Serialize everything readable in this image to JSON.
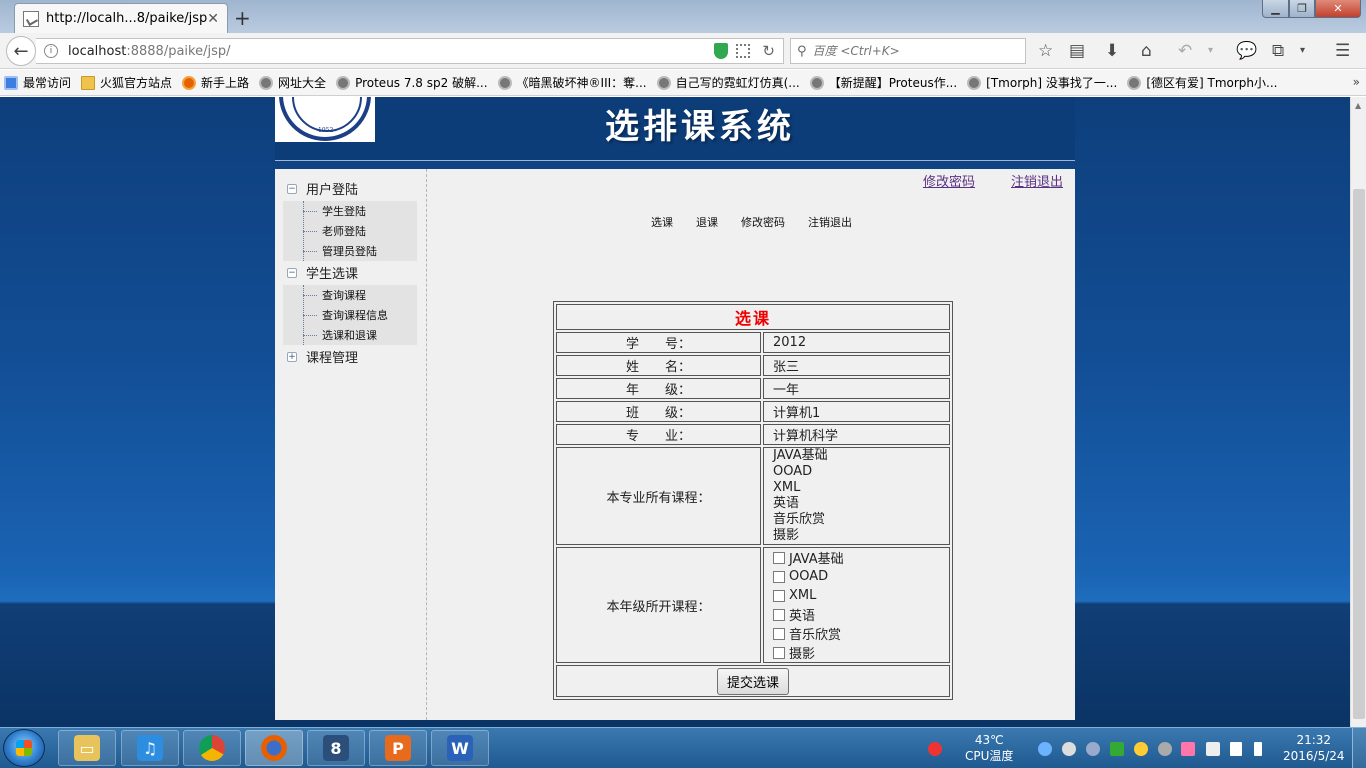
{
  "browser": {
    "tab_title": "http://localh...8/paike/jsp/",
    "url_host": "localhost",
    "url_rest": ":8888/paike/jsp/",
    "search_placeholder": "百度 <Ctrl+K>",
    "bookmarks": [
      {
        "label": "最常访问",
        "icon": "blue"
      },
      {
        "label": "火狐官方站点",
        "icon": "folder"
      },
      {
        "label": "新手上路",
        "icon": "fox"
      },
      {
        "label": "网址大全",
        "icon": "globe"
      },
      {
        "label": "Proteus 7.8 sp2 破解...",
        "icon": "globe"
      },
      {
        "label": "《暗黑破坏神®III：奪...",
        "icon": "globe"
      },
      {
        "label": "自己写的霓虹灯仿真(...",
        "icon": "globe"
      },
      {
        "label": "【新提醒】Proteus作...",
        "icon": "globe"
      },
      {
        "label": "[Tmorph] 没事找了一...",
        "icon": "globe"
      },
      {
        "label": "[德区有爱] Tmorph小...",
        "icon": "globe"
      }
    ]
  },
  "header": {
    "title": "选排课系统",
    "logo_year": "1952"
  },
  "sidebar": {
    "groups": [
      {
        "label": "用户登陆",
        "toggle": "−",
        "items": [
          "学生登陆",
          "老师登陆",
          "管理员登陆"
        ]
      },
      {
        "label": "学生选课",
        "toggle": "−",
        "items": [
          "查询课程",
          "查询课程信息",
          "选课和退课"
        ]
      },
      {
        "label": "课程管理",
        "toggle": "+",
        "items": []
      }
    ]
  },
  "toplinks": {
    "change_password": "修改密码",
    "logout": "注销退出"
  },
  "menu": [
    "选课",
    "退课",
    "修改密码",
    "注销退出"
  ],
  "form": {
    "title": "选课",
    "fields": [
      {
        "label": "学　　号：",
        "value": "2012"
      },
      {
        "label": "姓　　名：",
        "value": "张三"
      },
      {
        "label": "年　　级：",
        "value": "一年"
      },
      {
        "label": "班　　级：",
        "value": "计算机1"
      },
      {
        "label": "专　　业：",
        "value": "计算机科学"
      }
    ],
    "all_courses_label": "本专业所有课程：",
    "all_courses": [
      "JAVA基础",
      "OOAD",
      "XML",
      "英语",
      "音乐欣赏",
      "摄影"
    ],
    "grade_courses_label": "本年级所开课程：",
    "grade_courses": [
      {
        "label": "JAVA基础",
        "checked": false
      },
      {
        "label": "OOAD",
        "checked": false
      },
      {
        "label": "XML",
        "checked": false
      },
      {
        "label": "英语",
        "checked": false
      },
      {
        "label": "音乐欣赏",
        "checked": false
      },
      {
        "label": "摄影",
        "checked": false
      }
    ],
    "submit_label": "提交选课"
  },
  "taskbar": {
    "temp_value": "43℃",
    "temp_label": "CPU温度",
    "time": "21:32",
    "date": "2016/5/24"
  }
}
